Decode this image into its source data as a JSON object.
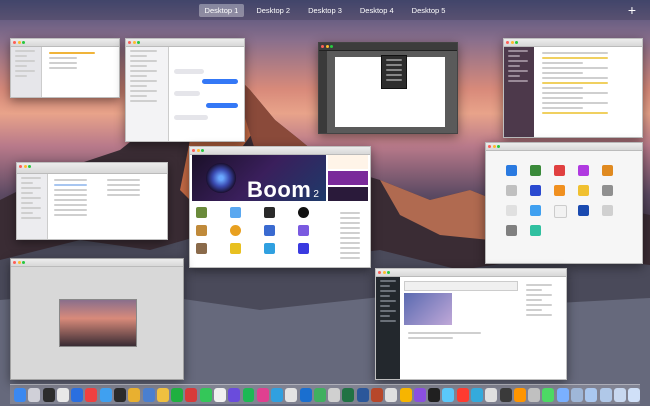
{
  "mission_control": {
    "spaces": [
      "Desktop 1",
      "Desktop 2",
      "Desktop 3",
      "Desktop 4",
      "Desktop 5"
    ],
    "active_space": "Desktop 1",
    "add_space_symbol": "+"
  },
  "windows": {
    "boom": {
      "title": "Boom",
      "version": "2"
    }
  },
  "dock": {
    "icon_colors": [
      "#3a88f0",
      "#d0d0d8",
      "#2c2c2c",
      "#e8e8e8",
      "#2a6fe0",
      "#f04040",
      "#3fa0f0",
      "#2b2b2b",
      "#e8b030",
      "#4a7fd0",
      "#f0c040",
      "#1fb040",
      "#d83a3a",
      "#34c759",
      "#f0f0f0",
      "#6a4cdc",
      "#1db954",
      "#e04090",
      "#30a0e0",
      "#e4e4e4",
      "#1a6fd0",
      "#40b060",
      "#d0d0d0",
      "#207244",
      "#2b579a",
      "#b7472a",
      "#e0e0e0",
      "#f7b500",
      "#8a4fe0",
      "#202020",
      "#5ac8fa",
      "#ff3b30",
      "#34aadc",
      "#e0e0e0",
      "#3a3a3a",
      "#ff9500",
      "#c0c0c0",
      "#4cd964",
      "#7ab0ff",
      "#9fb7d8",
      "#aac8f0",
      "#b0c8e8",
      "#c8d8f0",
      "#d0e0f8"
    ]
  }
}
